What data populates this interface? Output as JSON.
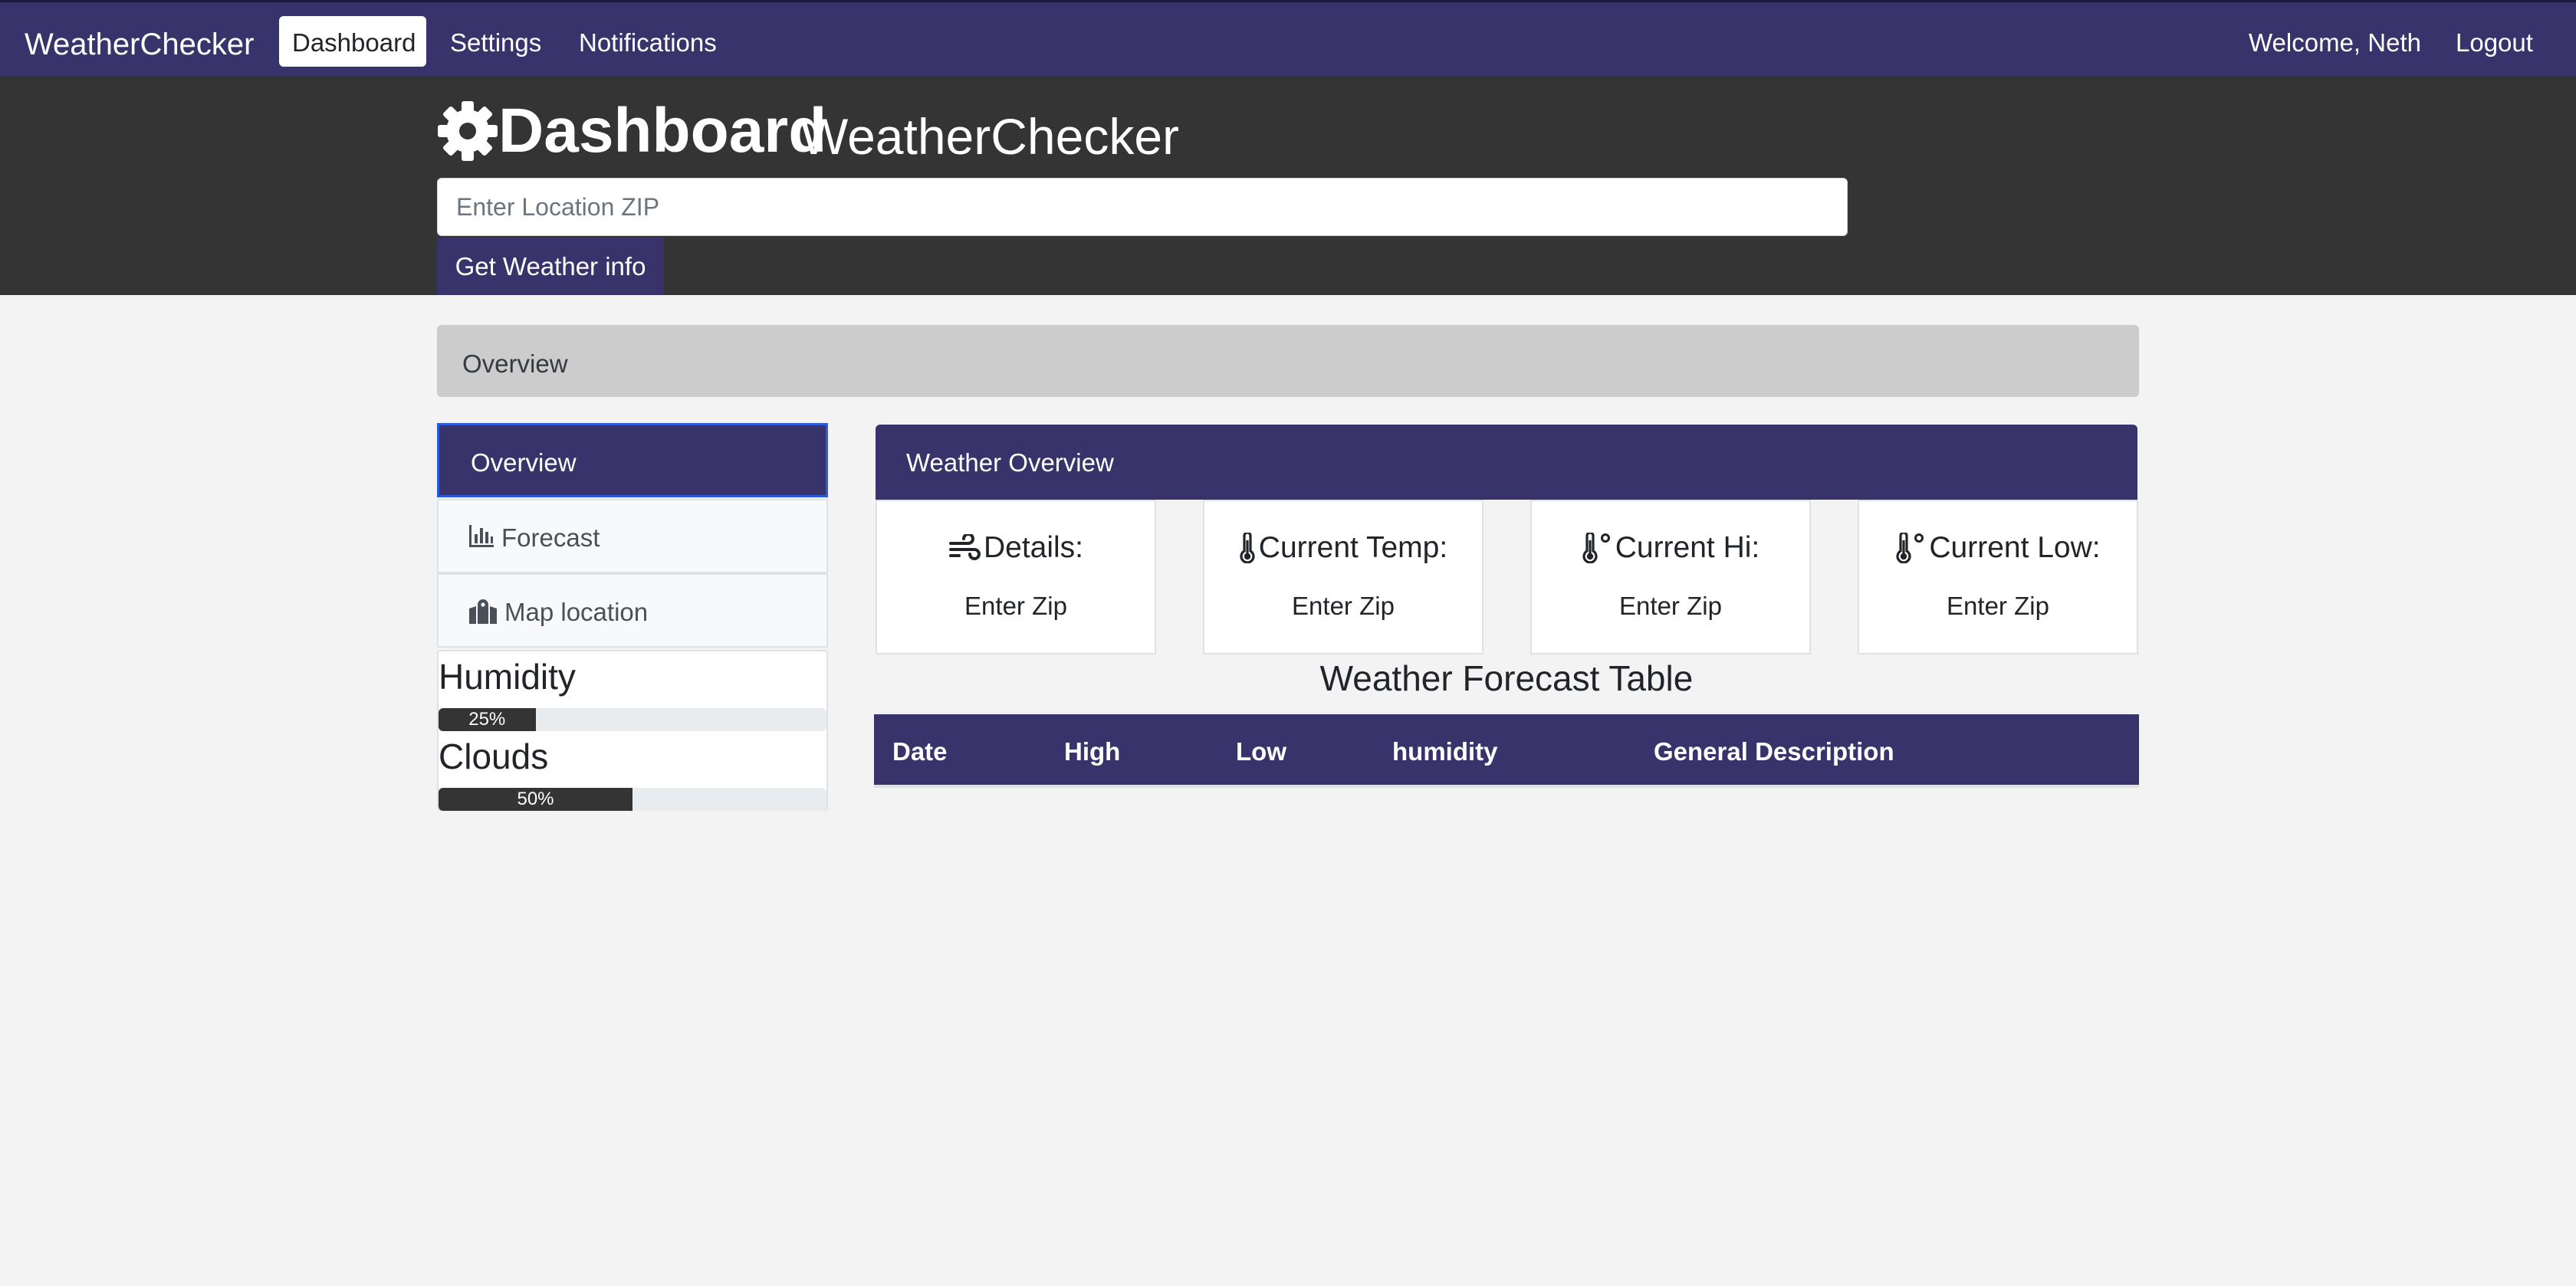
{
  "navbar": {
    "brand": "WeatherChecker",
    "links": [
      "Dashboard",
      "Settings",
      "Notifications"
    ],
    "active": "Dashboard",
    "welcome": "Welcome, Neth",
    "logout": "Logout"
  },
  "hero": {
    "title": "Dashboard",
    "subtitle": "WeatherChecker",
    "zip_placeholder": "Enter Location ZIP",
    "zip_value": "",
    "button": "Get Weather info"
  },
  "breadcrumb": "Overview",
  "sidebar": {
    "items": [
      {
        "label": "Overview",
        "icon": "none",
        "active": true
      },
      {
        "label": "Forecast",
        "icon": "bar-chart-icon",
        "active": false
      },
      {
        "label": "Map location",
        "icon": "map-location-icon",
        "active": false
      }
    ]
  },
  "metrics": {
    "humidity": {
      "label": "Humidity",
      "text": "25%",
      "value": 25
    },
    "clouds": {
      "label": "Clouds",
      "text": "50%",
      "value": 50
    }
  },
  "overview": {
    "header": "Weather Overview",
    "cards": [
      {
        "title": "Details:",
        "value": "Enter Zip",
        "icon": "wind-icon"
      },
      {
        "title": "Current Temp:",
        "value": "Enter Zip",
        "icon": "thermometer-icon"
      },
      {
        "title": "Current Hi:",
        "value": "Enter Zip",
        "icon": "thermometer-degree-icon"
      },
      {
        "title": "Current Low:",
        "value": "Enter Zip",
        "icon": "thermometer-degree-icon"
      }
    ]
  },
  "forecast_table": {
    "title": "Weather Forecast Table",
    "columns": [
      "Date",
      "High",
      "Low",
      "humidity",
      "General Description"
    ],
    "rows": []
  },
  "colors": {
    "primary": "#38336b",
    "hero_bg": "#343434",
    "page_bg": "#f3f3f3",
    "breadcrumb_bg": "#cccccc",
    "active_border": "#2c5cdc"
  }
}
